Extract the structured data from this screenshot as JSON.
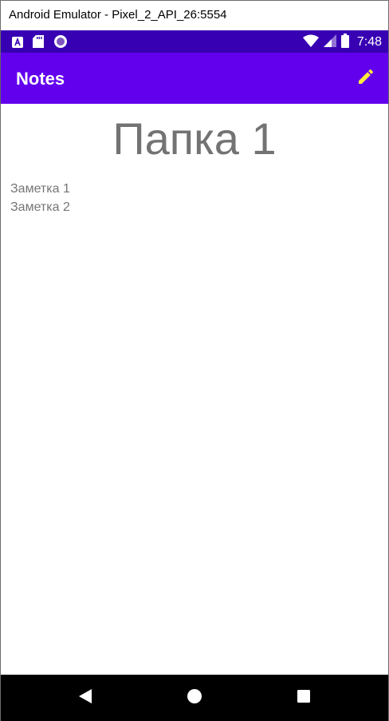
{
  "window": {
    "title": "Android Emulator - Pixel_2_API_26:5554"
  },
  "status_bar": {
    "time": "7:48",
    "icons_left": [
      "a-notification-icon",
      "sd-card-icon",
      "circle-notification-icon"
    ],
    "icons_right": [
      "wifi-icon",
      "cell-signal-icon",
      "battery-icon"
    ],
    "bg_color": "#3700b3"
  },
  "app_bar": {
    "title": "Notes",
    "action_icon": "edit-pencil-icon",
    "bg_color": "#6200ee",
    "icon_color": "#ffeb3b"
  },
  "main": {
    "folder_title": "Папка 1",
    "notes": [
      {
        "label": "Заметка 1"
      },
      {
        "label": "Заметка 2"
      }
    ]
  },
  "nav_bar": {
    "buttons": [
      "back-icon",
      "home-icon",
      "recents-icon"
    ]
  }
}
